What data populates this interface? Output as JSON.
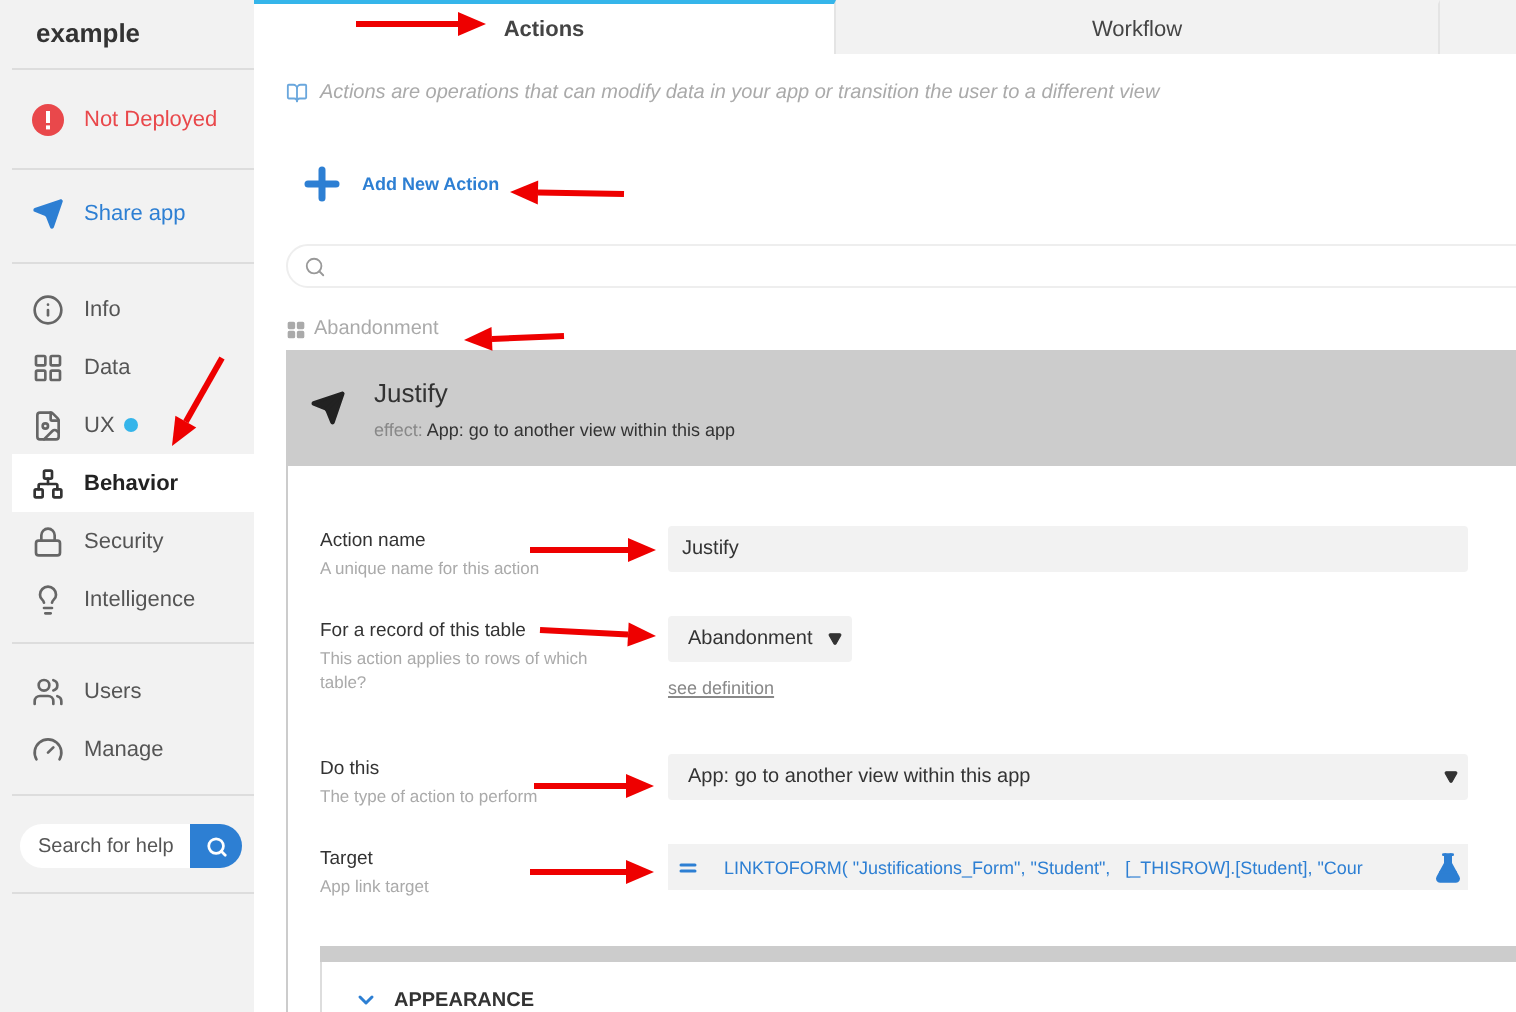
{
  "sidebar": {
    "app_name": "example",
    "status": "Not Deployed",
    "share": "Share app",
    "groups": [
      [
        {
          "label": "Info",
          "selected": false,
          "notification": false
        },
        {
          "label": "Data",
          "selected": false,
          "notification": false
        },
        {
          "label": "UX",
          "selected": false,
          "notification": true
        },
        {
          "label": "Behavior",
          "selected": true,
          "notification": false
        },
        {
          "label": "Security",
          "selected": false,
          "notification": false
        },
        {
          "label": "Intelligence",
          "selected": false,
          "notification": false
        }
      ],
      [
        {
          "label": "Users",
          "selected": false,
          "notification": false
        },
        {
          "label": "Manage",
          "selected": false,
          "notification": false
        }
      ]
    ],
    "search": {
      "placeholder": "Search for help"
    }
  },
  "tabs": [
    {
      "label": "Actions",
      "selected": true
    },
    {
      "label": "Workflow",
      "selected": false
    }
  ],
  "description": "Actions are operations that can modify data in your app or transition the user to a different view",
  "add_button": "Add New Action",
  "group_label": "Abandonment",
  "action": {
    "title": "Justify",
    "effect_prefix": "effect:",
    "effect": "App: go to another view within this app",
    "fields": [
      {
        "kind": "text",
        "label": "Action name",
        "hint": "A unique name for this action",
        "value": "Justify"
      },
      {
        "kind": "select",
        "label": "For a record of this table",
        "hint": "This action applies to rows of which table?",
        "value": "Abandonment",
        "link": "see definition"
      },
      {
        "kind": "wideselect",
        "label": "Do this",
        "hint": "The type of action to perform",
        "value": "App: go to another view within this app"
      },
      {
        "kind": "expression",
        "label": "Target",
        "hint": "App link target",
        "value": "LINKTOFORM( \"Justifications_Form\", \"Student\",   [_THISROW].[Student], \"Cour"
      }
    ],
    "section": "APPEARANCE"
  }
}
